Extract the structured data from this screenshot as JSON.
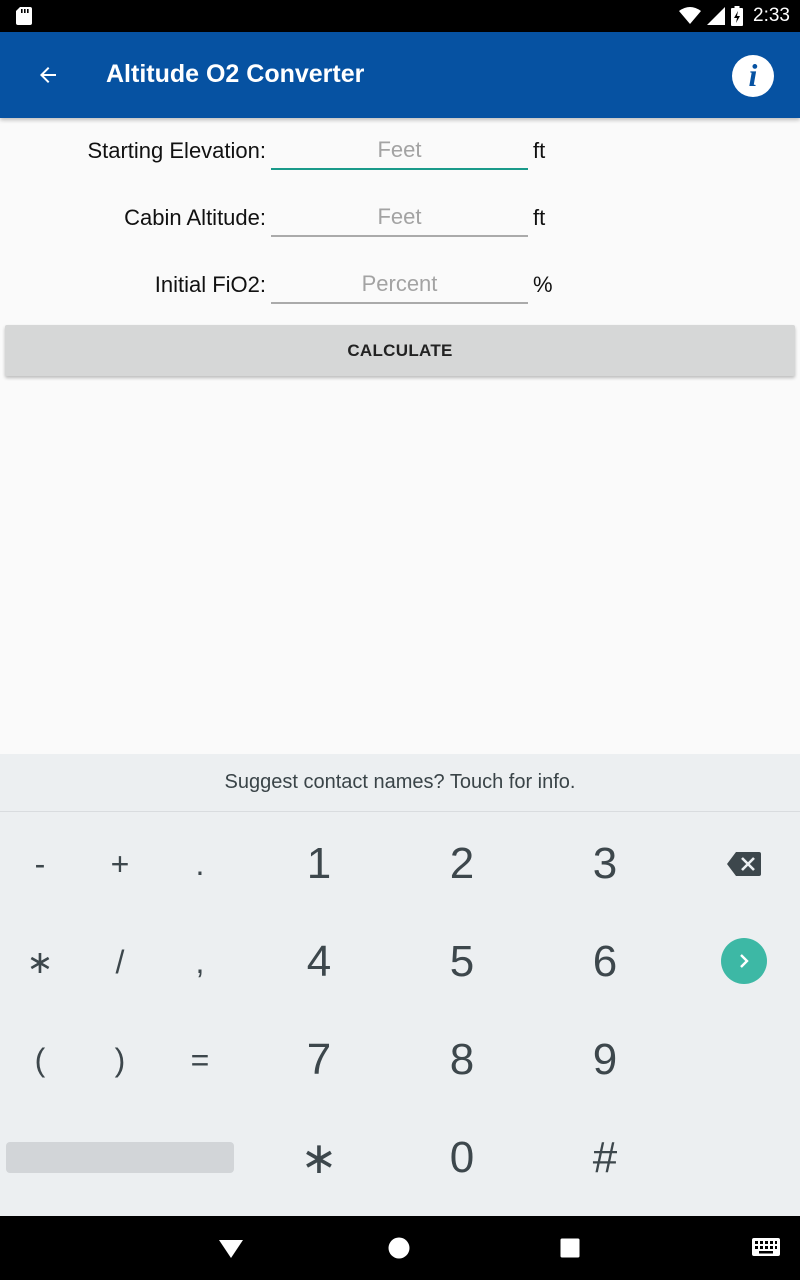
{
  "status_bar": {
    "time": "2:33",
    "icons": [
      "sd-card-icon",
      "wifi-icon",
      "signal-icon",
      "battery-charging-icon"
    ]
  },
  "app_bar": {
    "title": "Altitude O2 Converter",
    "back_icon": "arrow-back-icon",
    "info_icon": "info-icon"
  },
  "form": {
    "rows": [
      {
        "label": "Starting Elevation:",
        "placeholder": "Feet",
        "value": "",
        "unit": "ft",
        "focused": true
      },
      {
        "label": "Cabin Altitude:",
        "placeholder": "Feet",
        "value": "",
        "unit": "ft",
        "focused": false
      },
      {
        "label": "Initial FiO2:",
        "placeholder": "Percent",
        "value": "",
        "unit": "%",
        "focused": false
      }
    ],
    "calculate_label": "CALCULATE"
  },
  "keyboard": {
    "suggestion": "Suggest contact names? Touch for info.",
    "symbol_keys": [
      "-",
      "+",
      ".",
      "∗",
      "/",
      ",",
      "(",
      ")",
      "="
    ],
    "number_keys": [
      "1",
      "2",
      "3",
      "4",
      "5",
      "6",
      "7",
      "8",
      "9",
      "∗",
      "0",
      "#"
    ]
  },
  "nav_bar": {
    "icons": [
      "back-triangle-icon",
      "home-circle-icon",
      "recents-square-icon",
      "keyboard-icon"
    ]
  },
  "colors": {
    "app_bar": "#0652a2",
    "accent": "#1a9a8a",
    "enter_key": "#3db8a5",
    "keyboard_bg": "#eceff1"
  }
}
